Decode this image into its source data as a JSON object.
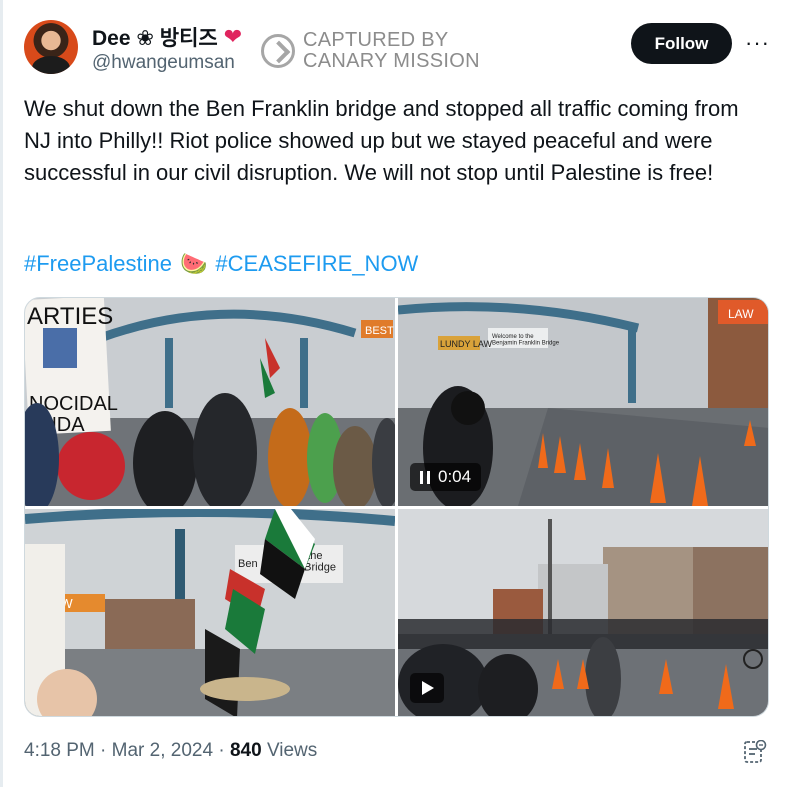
{
  "author": {
    "display_name": "Dee ❀ 방티즈",
    "heart": "❤",
    "handle": "@hwangeumsan"
  },
  "watermark": {
    "line1": "CAPTURED BY",
    "line2": "CANARY MISSION"
  },
  "follow_label": "Follow",
  "more_label": "···",
  "tweet": {
    "text": "We shut down the Ben Franklin bridge and stopped all traffic coming from NJ into Philly!! Riot police showed up but we stayed peaceful and were successful in our civil disruption. We will not stop until Palestine is free!",
    "hashtags": [
      "#FreePalestine",
      "#CEASEFIRE_NOW"
    ],
    "hashtag_emoji": "🍉"
  },
  "media": {
    "tile1": {
      "sign_top": "ARTIES",
      "sign_bottom": "NOCIDAL\nENDA",
      "banner": "BEST"
    },
    "tile2": {
      "video_time": "0:04",
      "bridge_sign": "Welcome to the\nBenjamin Franklin Bridge",
      "billboard": "LUNDY LAW",
      "billboard_right": "LAW"
    },
    "tile3": {
      "bridge_sign": "to the\nn Bridge",
      "sign_left": "Ben",
      "billboard": "LAW"
    },
    "tile4": {}
  },
  "footer": {
    "time": "4:18 PM",
    "date": "Mar 2, 2024",
    "views_count": "840",
    "views_label": "Views"
  },
  "colors": {
    "link": "#1d9bf0",
    "follow_bg": "#0f1419",
    "heart": "#e0245e"
  }
}
